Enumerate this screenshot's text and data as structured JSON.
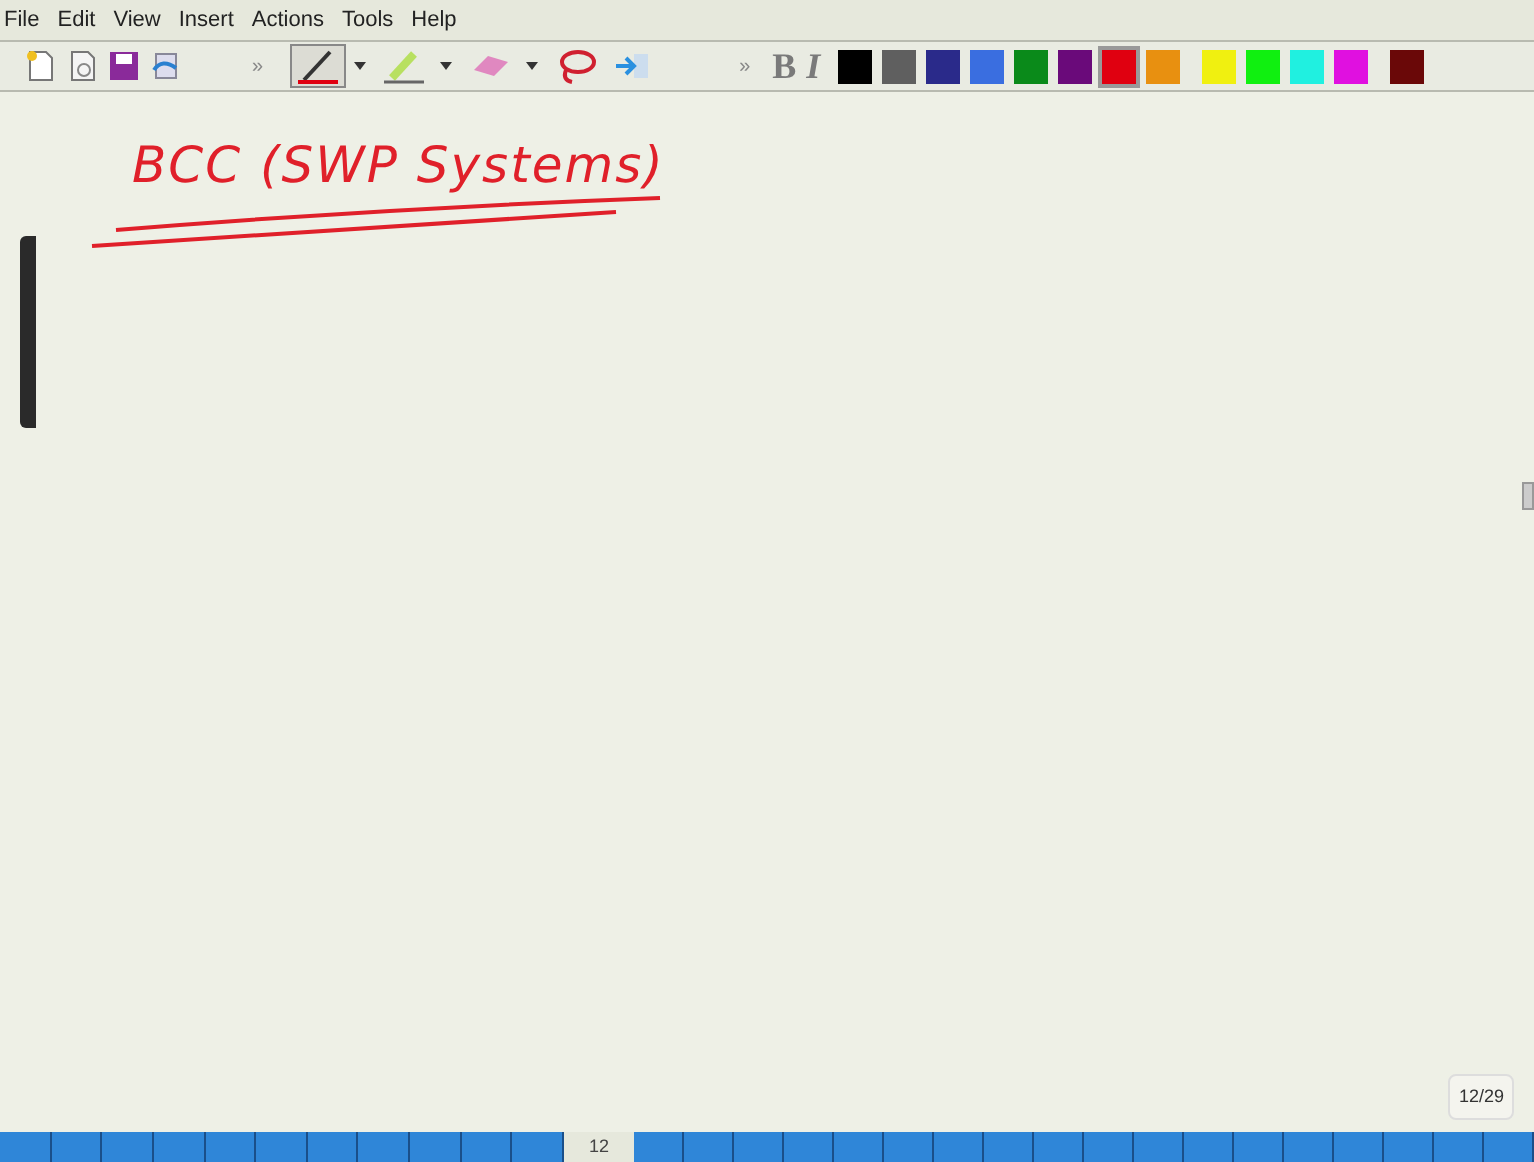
{
  "menu": [
    "File",
    "Edit",
    "View",
    "Insert",
    "Actions",
    "Tools",
    "Help"
  ],
  "toolbar": {
    "overflow_left": "»",
    "overflow_right": "»",
    "tools": [
      {
        "kind": "pen",
        "selected": true
      },
      {
        "kind": "highlighter",
        "selected": false
      },
      {
        "kind": "eraser",
        "selected": false
      },
      {
        "kind": "lasso",
        "selected": false
      }
    ],
    "bold": "B",
    "italic": "I",
    "colors": [
      {
        "color": "#000000",
        "selected": false
      },
      {
        "color": "#5f5f5f",
        "selected": false
      },
      {
        "color": "#2a2a8a",
        "selected": false
      },
      {
        "color": "#3a6ee0",
        "selected": false
      },
      {
        "color": "#0a8a1a",
        "selected": false
      },
      {
        "color": "#6a0a7a",
        "selected": false
      },
      {
        "color": "#e00010",
        "selected": true
      },
      {
        "color": "#e89010",
        "selected": false
      },
      {
        "color": "#f0f010",
        "selected": false
      },
      {
        "color": "#10f010",
        "selected": false
      },
      {
        "color": "#20f0e0",
        "selected": false
      },
      {
        "color": "#e010e0",
        "selected": false
      },
      {
        "color": "#6a0808",
        "selected": false
      }
    ]
  },
  "canvas": {
    "handwriting": "BCC (SWP Systems)",
    "page_counter": "12/29"
  },
  "page_strip": {
    "current": "12"
  }
}
